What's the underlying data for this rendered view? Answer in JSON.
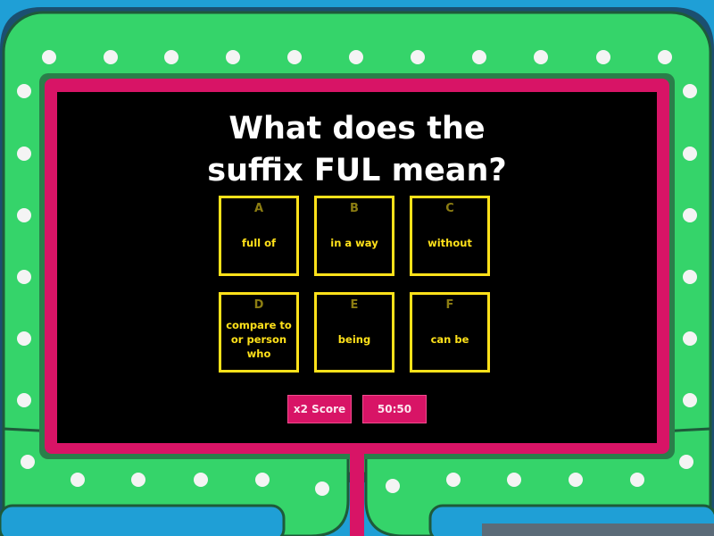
{
  "question": {
    "line1": "What does the",
    "line2": "suffix FUL mean?"
  },
  "answers": [
    {
      "letter": "A",
      "text": "full of"
    },
    {
      "letter": "B",
      "text": "in a way"
    },
    {
      "letter": "C",
      "text": "without"
    },
    {
      "letter": "D",
      "text": "compare to or person who"
    },
    {
      "letter": "E",
      "text": "being"
    },
    {
      "letter": "F",
      "text": "can be"
    }
  ],
  "powerups": {
    "double_score": "x2 Score",
    "fifty_fifty": "50:50"
  },
  "colors": {
    "background_blue": "#1f9fd6",
    "frame_green": "#35d46a",
    "frame_dark": "#1e5a3a",
    "frame_pink": "#d81466",
    "screen_black": "#000000",
    "answer_yellow": "#ffe11a",
    "bulb_white": "#f4f4f4"
  }
}
